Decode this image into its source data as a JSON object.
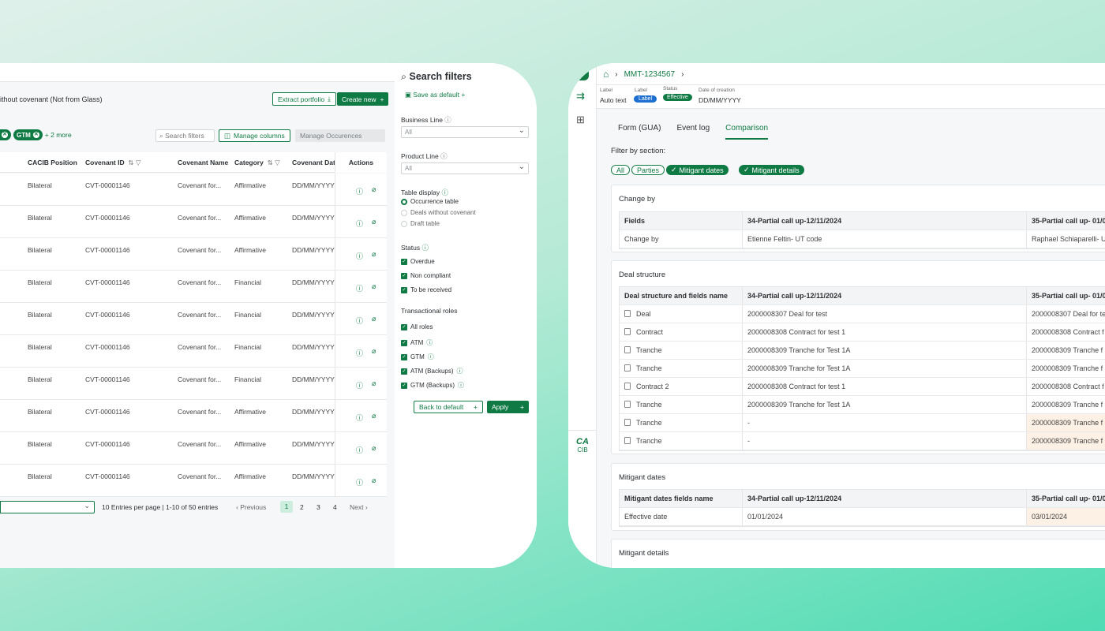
{
  "left": {
    "header_text": "ithout covenant (Not from Glass)",
    "extract_label": "Extract portfolio",
    "create_label": "Create new",
    "chips": [
      "GTM"
    ],
    "more_label": "+ 2 more",
    "search_placeholder": "Search filters",
    "manage_columns": "Manage columns",
    "manage_occurences": "Manage Occurences",
    "columns": {
      "cacib": "CACIB Position",
      "covid": "Covenant ID",
      "name": "Covenant Name",
      "cat": "Category",
      "date": "Covenant Dat",
      "actions": "Actions"
    },
    "rows": [
      {
        "pos": "Bilateral",
        "id": "CVT-00001146",
        "name": "Covenant for...",
        "cat": "Affirmative",
        "date": "DD/MM/YYYY"
      },
      {
        "pos": "Bilateral",
        "id": "CVT-00001146",
        "name": "Covenant for...",
        "cat": "Affirmative",
        "date": "DD/MM/YYYY"
      },
      {
        "pos": "Bilateral",
        "id": "CVT-00001146",
        "name": "Covenant for...",
        "cat": "Affirmative",
        "date": "DD/MM/YYYY"
      },
      {
        "pos": "Bilateral",
        "id": "CVT-00001146",
        "name": "Covenant for...",
        "cat": "Financial",
        "date": "DD/MM/YYYY"
      },
      {
        "pos": "Bilateral",
        "id": "CVT-00001146",
        "name": "Covenant for...",
        "cat": "Financial",
        "date": "DD/MM/YYYY"
      },
      {
        "pos": "Bilateral",
        "id": "CVT-00001146",
        "name": "Covenant for...",
        "cat": "Financial",
        "date": "DD/MM/YYYY"
      },
      {
        "pos": "Bilateral",
        "id": "CVT-00001146",
        "name": "Covenant for...",
        "cat": "Financial",
        "date": "DD/MM/YYYY"
      },
      {
        "pos": "Bilateral",
        "id": "CVT-00001146",
        "name": "Covenant for...",
        "cat": "Affirmative",
        "date": "DD/MM/YYYY"
      },
      {
        "pos": "Bilateral",
        "id": "CVT-00001146",
        "name": "Covenant for...",
        "cat": "Affirmative",
        "date": "DD/MM/YYYY"
      },
      {
        "pos": "Bilateral",
        "id": "CVT-00001146",
        "name": "Covenant for...",
        "cat": "Affirmative",
        "date": "DD/MM/YYYY"
      }
    ],
    "pagination": {
      "entries": "10 Entries per page | 1-10 of 50 entries",
      "prev": "Previous",
      "next": "Next",
      "pages": [
        "1",
        "2",
        "3",
        "4"
      ]
    }
  },
  "filters": {
    "title": "Search filters",
    "save_default": "Save as default",
    "business_line": "Business Line",
    "product_line": "Product Line",
    "all": "All",
    "table_display": "Table display",
    "display_options": [
      "Occurrence table",
      "Deals without covenant",
      "Draft table"
    ],
    "status": "Status",
    "status_options": [
      "Overdue",
      "Non compliant",
      "To be received"
    ],
    "roles": "Transactional roles",
    "role_options": [
      "All roles",
      "ATM",
      "GTM",
      "ATM (Backups)",
      "GTM (Backups)"
    ],
    "back_default": "Back to default",
    "apply": "Apply"
  },
  "right": {
    "breadcrumb": "MMT-1234567",
    "meta": {
      "label1": "Label",
      "value1": "Auto text",
      "label2": "Label",
      "badge2": "Label",
      "label3": "Status",
      "badge3": "Effective",
      "label4": "Date of creation",
      "value4": "DD/MM/YYYY"
    },
    "tabs": [
      "Form (GUA)",
      "Event log",
      "Comparison"
    ],
    "filter_by": "Filter by section:",
    "section_tags": [
      "All",
      "Parties",
      "Mitigant dates",
      "Mitigant details"
    ],
    "logo_text": "CIB",
    "change_by": {
      "title": "Change by",
      "headers": [
        "Fields",
        "34-Partial call up-12/11/2024",
        "35-Partial call up- 01/0"
      ],
      "rows": [
        [
          "Change by",
          "Etienne Feltin- UT code",
          "Raphael Schiaparelli- U"
        ]
      ]
    },
    "deal_structure": {
      "title": "Deal structure",
      "headers": [
        "Deal structure and fields name",
        "34-Partial call up-12/11/2024",
        "35-Partial call up- 01/0"
      ],
      "rows": [
        [
          "Deal",
          "2000008307 Deal for test",
          "2000008307 Deal for te"
        ],
        [
          "Contract",
          "2000008308 Contract for test 1",
          "2000008308 Contract f"
        ],
        [
          "Tranche",
          "2000008309 Tranche for Test 1A",
          "2000008309 Tranche f"
        ],
        [
          "Tranche",
          "2000008309 Tranche for Test 1A",
          "2000008309 Tranche f"
        ],
        [
          "Contract 2",
          "2000008308 Contract for test 1",
          "2000008308 Contract f"
        ],
        [
          "Tranche",
          "2000008309 Tranche for Test 1A",
          "2000008309 Tranche f"
        ],
        [
          "Tranche",
          "-",
          "2000008309 Tranche f"
        ],
        [
          "Tranche",
          "-",
          "2000008309 Tranche f"
        ]
      ]
    },
    "mitigant_dates": {
      "title": "Mitigant dates",
      "headers": [
        "Mitigant dates fields name",
        "34-Partial call up-12/11/2024",
        "35-Partial call up- 01/0"
      ],
      "rows": [
        [
          "Effective date",
          "01/01/2024",
          "03/01/2024"
        ]
      ]
    },
    "mitigant_details": {
      "title": "Mitigant details"
    }
  },
  "colors": {
    "brand": "#0f7a44",
    "highlight": "#fdf1e5",
    "badge_blue": "#1f6fd1"
  }
}
